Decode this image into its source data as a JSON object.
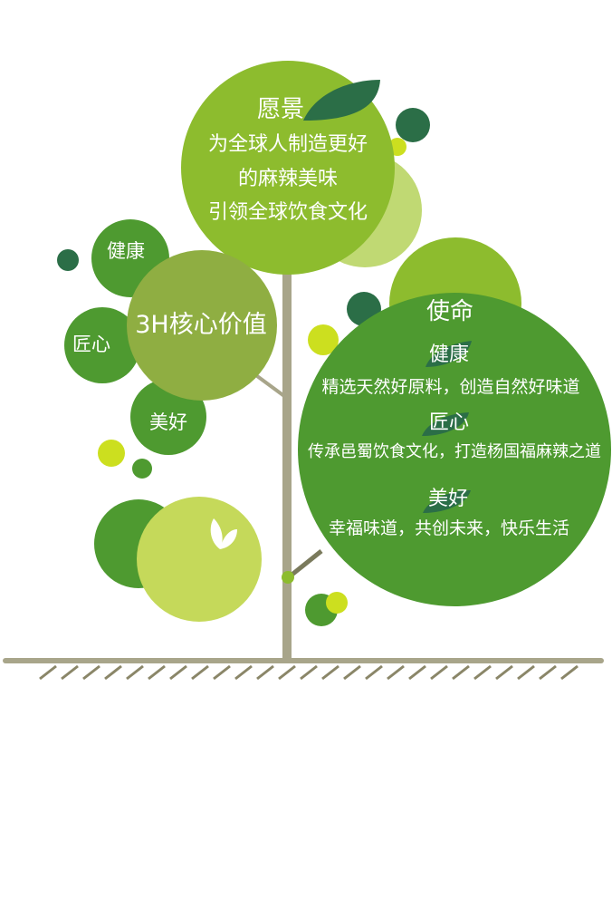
{
  "vision": {
    "title": "愿景",
    "lines": [
      "为全球人制造更好",
      "的麻辣美味",
      "引领全球饮食文化"
    ]
  },
  "core_values": {
    "title": "3H核心价值",
    "items": [
      "健康",
      "匠心",
      "美好"
    ]
  },
  "mission": {
    "title": "使命",
    "items": [
      {
        "heading": "健康",
        "text": "精选天然好原料，创造自然好味道"
      },
      {
        "heading": "匠心",
        "text": "传承邑蜀饮食文化，打造杨国福麻辣之道"
      },
      {
        "heading": "美好",
        "text": "幸福味道，共创未来，快乐生活"
      }
    ]
  },
  "colors": {
    "trunk": "#a8a58a",
    "dark_green": "#2b6e47",
    "mid_green": "#4e9a30",
    "light_green": "#8dbc2e",
    "olive": "#8fae42",
    "pale_green": "#c5d95a",
    "yellow_green": "#ccdf1f"
  }
}
